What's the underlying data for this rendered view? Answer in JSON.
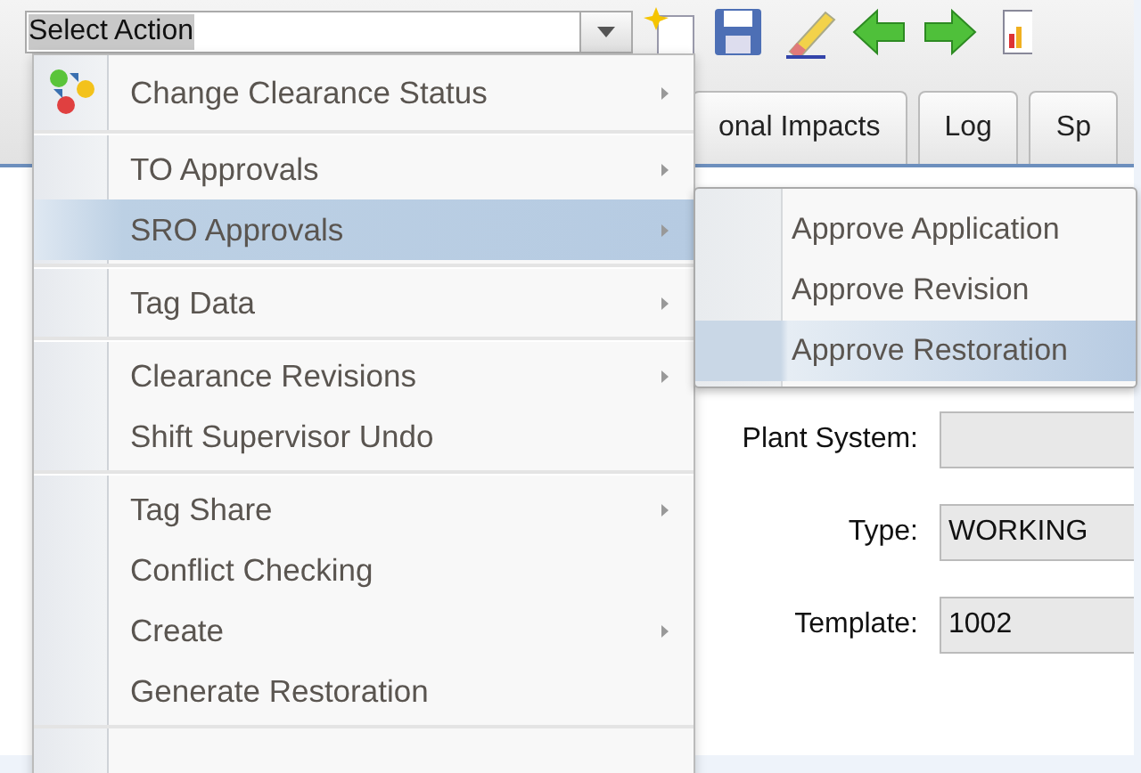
{
  "action_select": {
    "value": "Select Action"
  },
  "tabs": [
    {
      "label": "onal Impacts",
      "selected": false
    },
    {
      "label": "Log",
      "selected": false
    },
    {
      "label": "Sp",
      "selected": false
    }
  ],
  "form": [
    {
      "label": "Plant System:"
    },
    {
      "label": "Type:",
      "value": "WORKING"
    },
    {
      "label": "Template:",
      "value": "1002"
    }
  ],
  "menu": {
    "groups": [
      [
        {
          "label": "Change Clearance Status",
          "submenu": true,
          "selected": false,
          "has_icon": true
        }
      ],
      [
        {
          "label": "TO Approvals",
          "submenu": true,
          "selected": false
        },
        {
          "label": "SRO Approvals",
          "submenu": true,
          "selected": true
        }
      ],
      [
        {
          "label": "Tag Data",
          "submenu": true,
          "selected": false
        }
      ],
      [
        {
          "label": "Clearance Revisions",
          "submenu": true,
          "selected": false
        },
        {
          "label": "Shift Supervisor Undo",
          "submenu": false,
          "selected": false
        }
      ],
      [
        {
          "label": "Tag Share",
          "submenu": true,
          "selected": false
        },
        {
          "label": "Conflict Checking",
          "submenu": false,
          "selected": false
        },
        {
          "label": "Create",
          "submenu": true,
          "selected": false
        },
        {
          "label": "Generate Restoration",
          "submenu": false,
          "selected": false
        }
      ]
    ]
  },
  "submenu": {
    "items": [
      {
        "label": "Approve Application",
        "selected": false
      },
      {
        "label": "Approve Revision",
        "selected": false
      },
      {
        "label": "Approve Restoration",
        "selected": true
      }
    ]
  }
}
